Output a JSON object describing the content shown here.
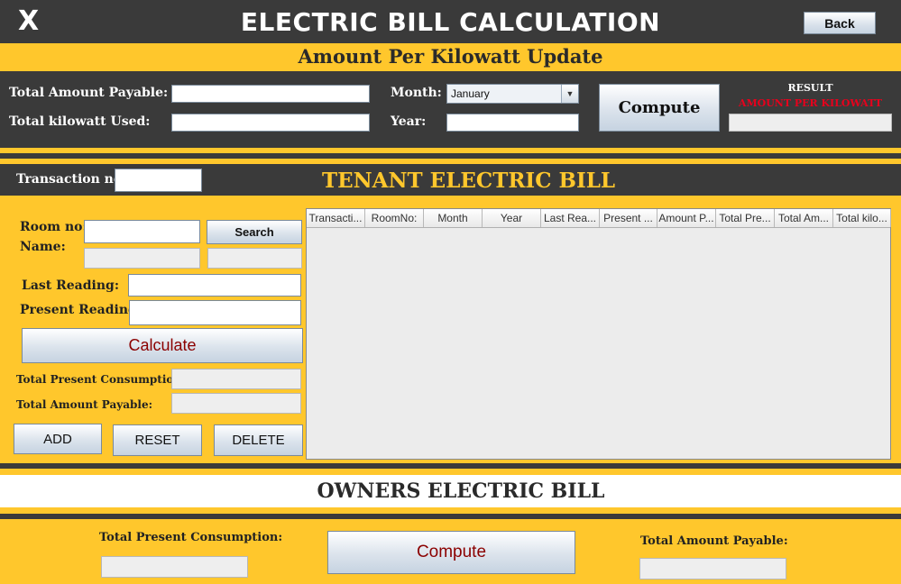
{
  "header": {
    "close_icon": "X",
    "title": "ELECTRIC BILL CALCULATION",
    "back_label": "Back"
  },
  "kilowatt_update": {
    "heading": "Amount Per Kilowatt Update",
    "total_amount_label": "Total Amount Payable:",
    "total_amount_value": "",
    "total_kw_label": "Total kilowatt Used:",
    "total_kw_value": "",
    "month_label": "Month:",
    "month_value": "January",
    "year_label": "Year:",
    "year_value": "",
    "compute_label": "Compute",
    "result_label": "RESULT",
    "result_sublabel": "AMOUNT PER KILOWATT",
    "result_value": ""
  },
  "tenant": {
    "transaction_label": "Transaction no:",
    "transaction_value": "",
    "heading": "TENANT ELECTRIC BILL",
    "room_label": "Room no:",
    "name_label": "Name:",
    "search_label": "Search",
    "last_reading_label": "Last Reading:",
    "present_reading_label": "Present Reading:",
    "calculate_label": "Calculate",
    "total_present_label": "Total Present Consumption:",
    "total_payable_label": "Total Amount Payable:",
    "add_label": "ADD",
    "reset_label": "RESET",
    "delete_label": "DELETE",
    "table_headers": [
      "Transacti...",
      "RoomNo:",
      "Month",
      "Year",
      "Last Rea...",
      "Present ...",
      "Amount P...",
      "Total Pre...",
      "Total Am...",
      "Total kilo..."
    ]
  },
  "owners": {
    "heading": "OWNERS ELECTRIC BILL",
    "total_present_label": "Total Present Consumption:",
    "compute_label": "Compute",
    "total_payable_label": "Total Amount Payable:"
  },
  "colors": {
    "accent": "#FFC72C",
    "dark": "#3a3a3a",
    "heading_dark": "#2a2a2a",
    "result_red": "#e8001c",
    "button_red": "#8b0000"
  }
}
